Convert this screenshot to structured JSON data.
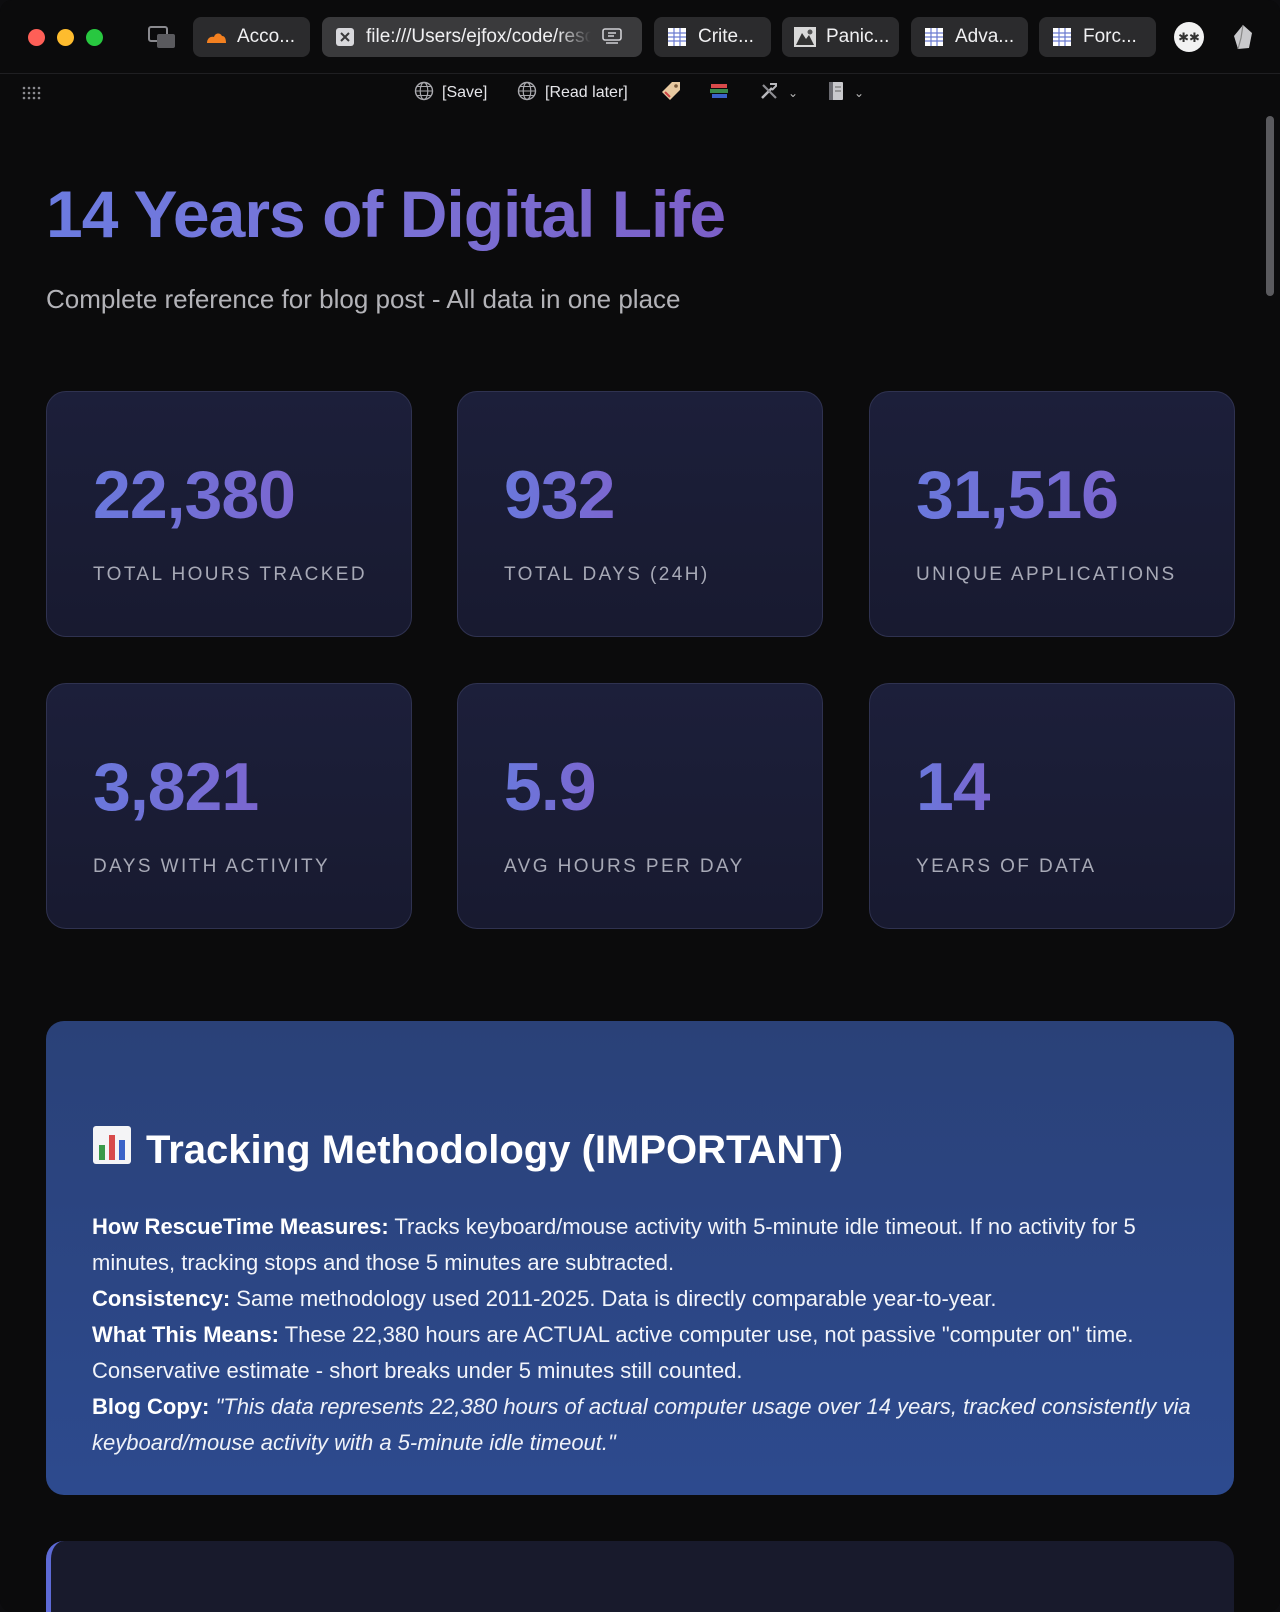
{
  "browser": {
    "tabs": [
      {
        "label": "Acco...",
        "icon": "cloudflare-icon"
      },
      {
        "label": "file:///Users/ejfox/code/rescuetime",
        "icon": "close-icon"
      },
      {
        "label": "Crite...",
        "icon": "spreadsheet-icon"
      },
      {
        "label": "Panic...",
        "icon": "image-icon"
      },
      {
        "label": "Adva...",
        "icon": "spreadsheet-icon"
      },
      {
        "label": "Forc...",
        "icon": "spreadsheet-icon"
      }
    ],
    "bookmarks": [
      {
        "label": "[Save]",
        "icon": "globe-icon"
      },
      {
        "label": "[Read later]",
        "icon": "globe-icon"
      }
    ]
  },
  "page": {
    "title": "14 Years of Digital Life",
    "subtitle": "Complete reference for blog post - All data in one place",
    "stats": [
      {
        "value": "22,380",
        "label": "TOTAL HOURS TRACKED"
      },
      {
        "value": "932",
        "label": "TOTAL DAYS (24H)"
      },
      {
        "value": "31,516",
        "label": "UNIQUE APPLICATIONS"
      },
      {
        "value": "3,821",
        "label": "DAYS WITH ACTIVITY"
      },
      {
        "value": "5.9",
        "label": "AVG HOURS PER DAY"
      },
      {
        "value": "14",
        "label": "YEARS OF DATA"
      }
    ],
    "methodology": {
      "heading": "Tracking Methodology (IMPORTANT)",
      "icon": "bar-chart-icon",
      "paragraphs": [
        {
          "label": "How RescueTime Measures:",
          "text": " Tracks keyboard/mouse activity with 5-minute idle timeout. If no activity for 5 minutes, tracking stops and those 5 minutes are subtracted."
        },
        {
          "label": "Consistency:",
          "text": " Same methodology used 2011-2025. Data is directly comparable year-to-year."
        },
        {
          "label": "What This Means:",
          "text": " These 22,380 hours are ACTUAL active computer use, not passive \"computer on\" time. Conservative estimate - short breaks under 5 minutes still counted."
        },
        {
          "label": "Blog Copy:",
          "text": "\"This data represents 22,380 hours of actual computer usage over 14 years, tracked consistently via keyboard/mouse activity with a 5-minute idle timeout.\""
        }
      ]
    }
  }
}
